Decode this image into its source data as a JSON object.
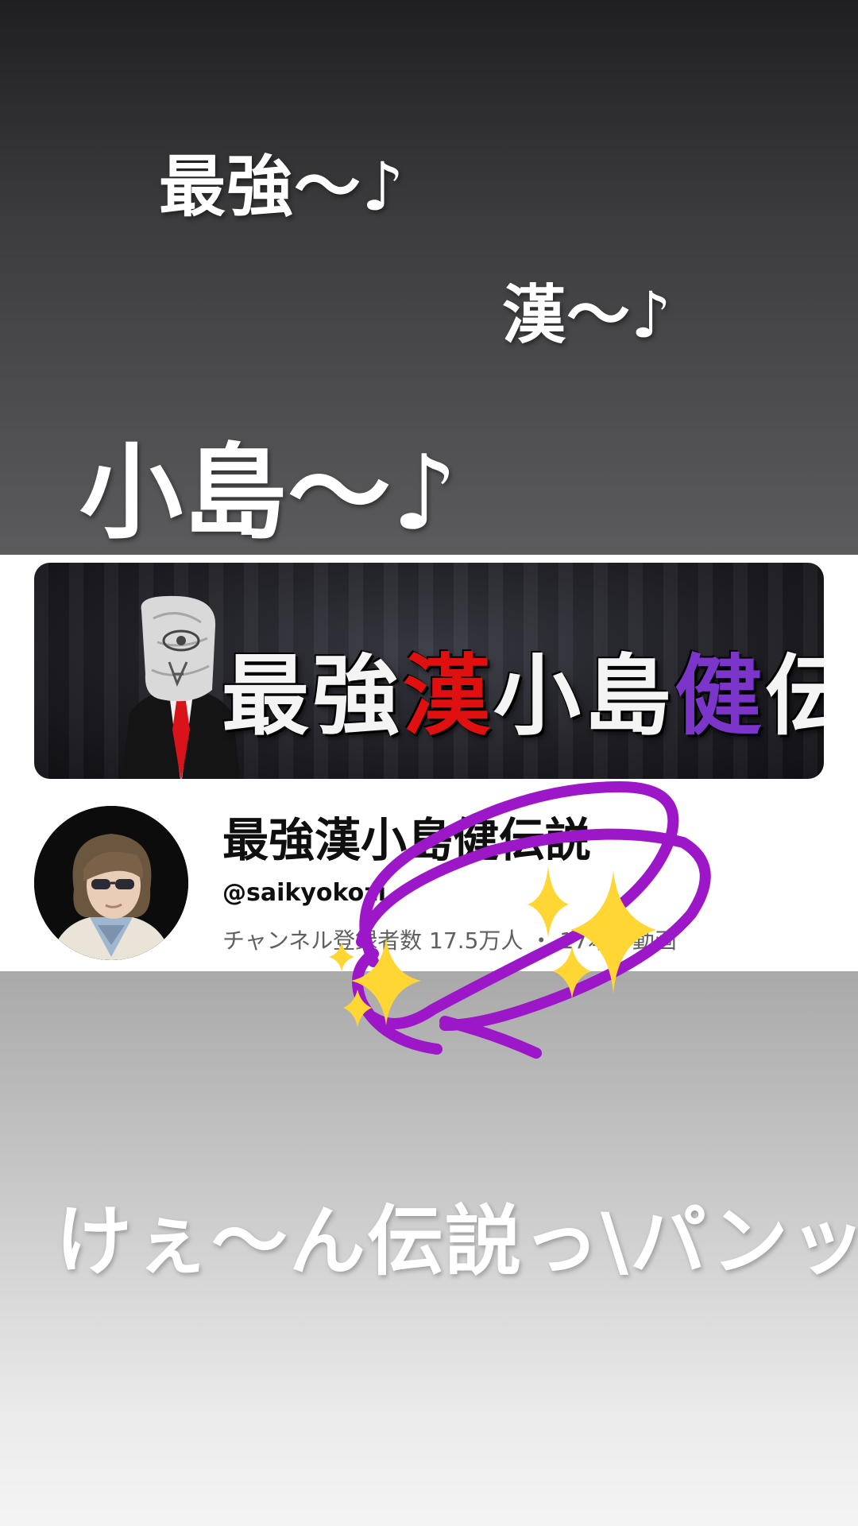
{
  "story": {
    "lyrics": [
      "最強〜♪",
      "漢〜♪",
      "小島〜♪"
    ],
    "tagline": "けぇ〜ん伝説っ\\パンッ/"
  },
  "banner": {
    "title_parts": [
      "最強",
      "漢",
      "小島",
      "健",
      "伝説"
    ],
    "title_colors": [
      "#f4f4f4",
      "#e01010",
      "#f4f4f4",
      "#7b35c9",
      "#f4f4f4"
    ]
  },
  "channel": {
    "name": "最強漢小島健伝説",
    "handle": "@saikyokozi",
    "stats": "チャンネル登録者数 17.5万人 ・ 17本の動画"
  },
  "stickers": {
    "scribble_color": "#9b17c8",
    "sparkle_color": "#ffd633",
    "icon": "sparkles-icon"
  }
}
